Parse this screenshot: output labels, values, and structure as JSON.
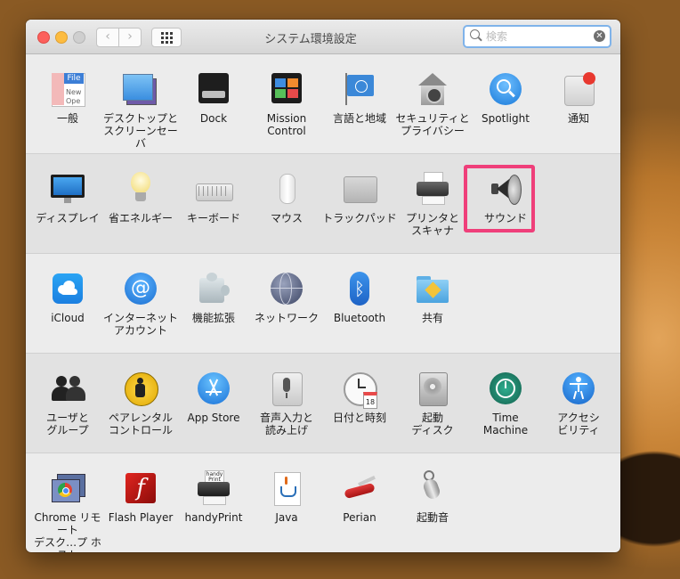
{
  "window": {
    "title": "システム環境設定",
    "back_glyph": "‹",
    "forward_glyph": "›",
    "search": {
      "value": "",
      "placeholder": "検索",
      "clear_glyph": "✕"
    }
  },
  "sections": [
    {
      "items": [
        {
          "label": "一般",
          "icon": "general-icon"
        },
        {
          "label": "デスクトップと\nスクリーンセーバ",
          "icon": "desktop-icon"
        },
        {
          "label": "Dock",
          "icon": "dock-icon"
        },
        {
          "label": "Mission\nControl",
          "icon": "mission-control-icon"
        },
        {
          "label": "言語と地域",
          "icon": "language-flag-icon"
        },
        {
          "label": "セキュリティと\nプライバシー",
          "icon": "security-house-icon"
        },
        {
          "label": "Spotlight",
          "icon": "spotlight-icon"
        },
        {
          "label": "通知",
          "icon": "notification-icon"
        }
      ]
    },
    {
      "items": [
        {
          "label": "ディスプレイ",
          "icon": "display-icon"
        },
        {
          "label": "省エネルギー",
          "icon": "energy-bulb-icon"
        },
        {
          "label": "キーボード",
          "icon": "keyboard-icon"
        },
        {
          "label": "マウス",
          "icon": "mouse-icon"
        },
        {
          "label": "トラックパッド",
          "icon": "trackpad-icon"
        },
        {
          "label": "プリンタと\nスキャナ",
          "icon": "printer-icon"
        },
        {
          "label": "サウンド",
          "icon": "speaker-icon"
        }
      ]
    },
    {
      "items": [
        {
          "label": "iCloud",
          "icon": "icloud-icon"
        },
        {
          "label": "インターネット\nアカウント",
          "icon": "at-sign-icon"
        },
        {
          "label": "機能拡張",
          "icon": "puzzle-icon"
        },
        {
          "label": "ネットワーク",
          "icon": "network-globe-icon"
        },
        {
          "label": "Bluetooth",
          "icon": "bluetooth-icon"
        },
        {
          "label": "共有",
          "icon": "sharing-folder-icon"
        }
      ]
    },
    {
      "items": [
        {
          "label": "ユーザと\nグループ",
          "icon": "users-icon"
        },
        {
          "label": "ペアレンタル\nコントロール",
          "icon": "parental-icon"
        },
        {
          "label": "App Store",
          "icon": "app-store-icon"
        },
        {
          "label": "音声入力と\n読み上げ",
          "icon": "microphone-icon"
        },
        {
          "label": "日付と時刻",
          "icon": "clock-icon"
        },
        {
          "label": "起動\nディスク",
          "icon": "disk-icon"
        },
        {
          "label": "Time\nMachine",
          "icon": "time-machine-icon"
        },
        {
          "label": "アクセシ\nビリティ",
          "icon": "accessibility-icon"
        }
      ]
    },
    {
      "items": [
        {
          "label": "Chrome リモート\nデスク…プ ホスト",
          "icon": "chrome-remote-icon"
        },
        {
          "label": "Flash Player",
          "icon": "flash-icon"
        },
        {
          "label": "handyPrint",
          "icon": "handyprint-icon"
        },
        {
          "label": "Java",
          "icon": "java-icon"
        },
        {
          "label": "Perian",
          "icon": "perian-knife-icon"
        },
        {
          "label": "起動音",
          "icon": "whistle-icon"
        }
      ]
    }
  ],
  "icon_texts": {
    "general_file": "File",
    "general_new": "New",
    "general_open": "Ope",
    "handyprint": "handy\nPrint",
    "calendar_day": "18",
    "flash_glyph": "f",
    "at_glyph": "@",
    "bluetooth_glyph": "ᛒ"
  },
  "highlighted_item": "サウンド"
}
